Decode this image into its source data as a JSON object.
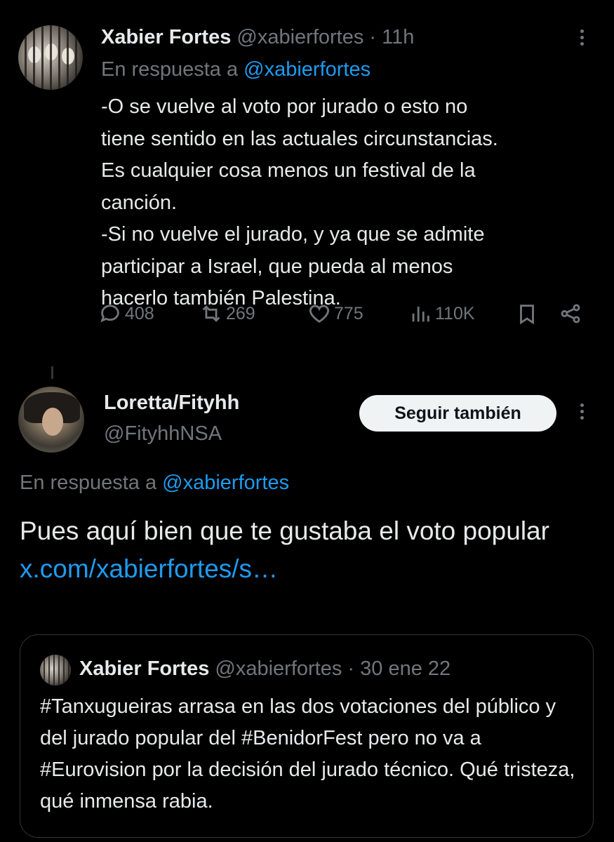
{
  "tweet1": {
    "author_name": "Xabier Fortes",
    "author_handle": "@xabierfortes",
    "time": "· 11h",
    "reply_prefix": "En respuesta a",
    "reply_handle": "@xabierfortes",
    "body": "-O se vuelve al voto por jurado o esto no\ntiene sentido en las actuales circunstancias.\nEs cualquier cosa menos un festival de la\ncanción.\n-Si no vuelve el jurado, y ya que se admite\nparticipar a Israel, que pueda al menos\nhacerlo también Palestina.",
    "actions": {
      "replies": "408",
      "reposts": "269",
      "likes": "775",
      "views": "110K"
    }
  },
  "tweet2": {
    "author_name": "Loretta/Fityhh",
    "author_handle": "@FityhhNSA",
    "follow_label": "Seguir también",
    "reply_prefix": "En respuesta a",
    "reply_handle": "@xabierfortes",
    "body_text": "Pues aquí bien que te gustaba el voto popular",
    "body_link": "x.com/xabierfortes/s…"
  },
  "quote": {
    "author_name": "Xabier Fortes",
    "author_handle": "@xabierfortes",
    "time": "· 30 ene 22",
    "body": "#Tanxugueiras arrasa en las dos votaciones del público y del jurado popular del #BenidorFest pero no va a #Eurovision por la decisión del jurado técnico. Qué tristeza, qué inmensa rabia."
  },
  "colors": {
    "background": "#000000",
    "text": "#e7e9ea",
    "muted": "#71767b",
    "link": "#1d9bf0",
    "border": "#2f3336"
  }
}
